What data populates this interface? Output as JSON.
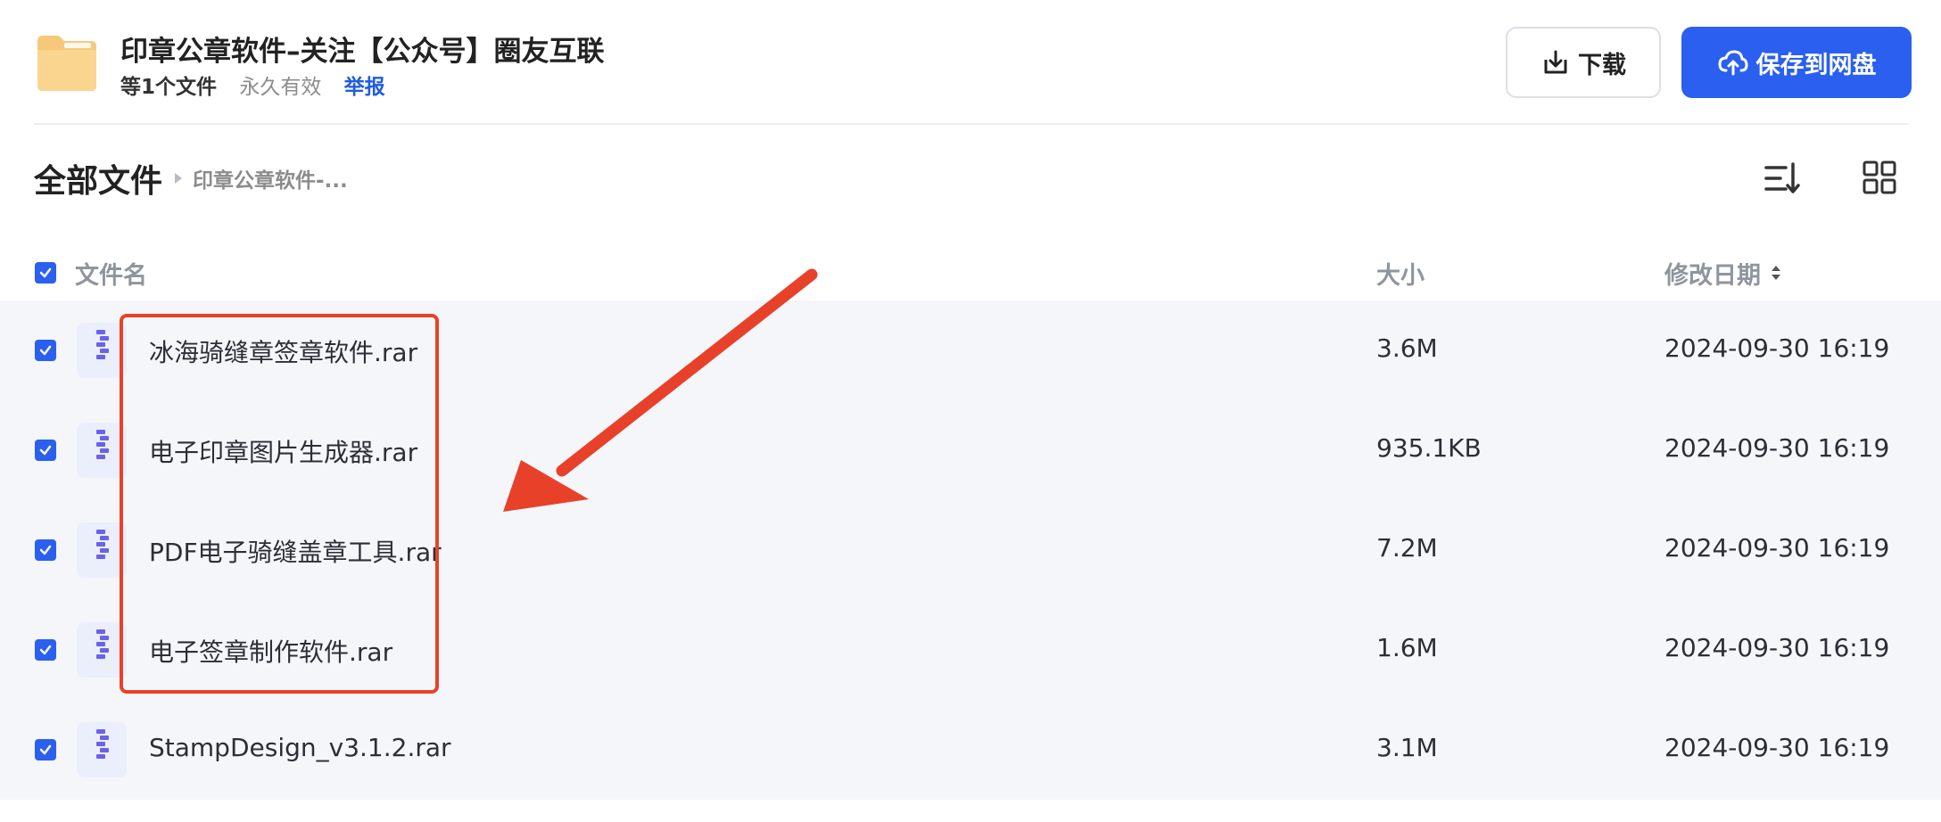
{
  "header": {
    "title": "印章公章软件–关注【公众号】圈友互联",
    "file_count": "等1个文件",
    "validity": "永久有效",
    "report": "举报",
    "download_label": "下载",
    "save_label": "保存到网盘"
  },
  "breadcrumb": {
    "root": "全部文件",
    "current": "印章公章软件-..."
  },
  "columns": {
    "name": "文件名",
    "size": "大小",
    "date": "修改日期"
  },
  "files": [
    {
      "name": "冰海骑缝章签章软件.rar",
      "size": "3.6M",
      "date": "2024-09-30 16:19"
    },
    {
      "name": "电子印章图片生成器.rar",
      "size": "935.1KB",
      "date": "2024-09-30 16:19"
    },
    {
      "name": "PDF电子骑缝盖章工具.rar",
      "size": "7.2M",
      "date": "2024-09-30 16:19"
    },
    {
      "name": "电子签章制作软件.rar",
      "size": "1.6M",
      "date": "2024-09-30 16:19"
    },
    {
      "name": "StampDesign_v3.1.2.rar",
      "size": "3.1M",
      "date": "2024-09-30 16:19"
    }
  ],
  "colors": {
    "accent": "#2a5ff0",
    "annotation": "#e8412a",
    "row_bg": "#f5f6fa"
  },
  "icons": {
    "folder": "folder-icon",
    "download": "download-icon",
    "cloud_upload": "cloud-upload-icon",
    "sort": "sort-icon",
    "grid": "grid-view-icon",
    "archive": "archive-file-icon"
  }
}
